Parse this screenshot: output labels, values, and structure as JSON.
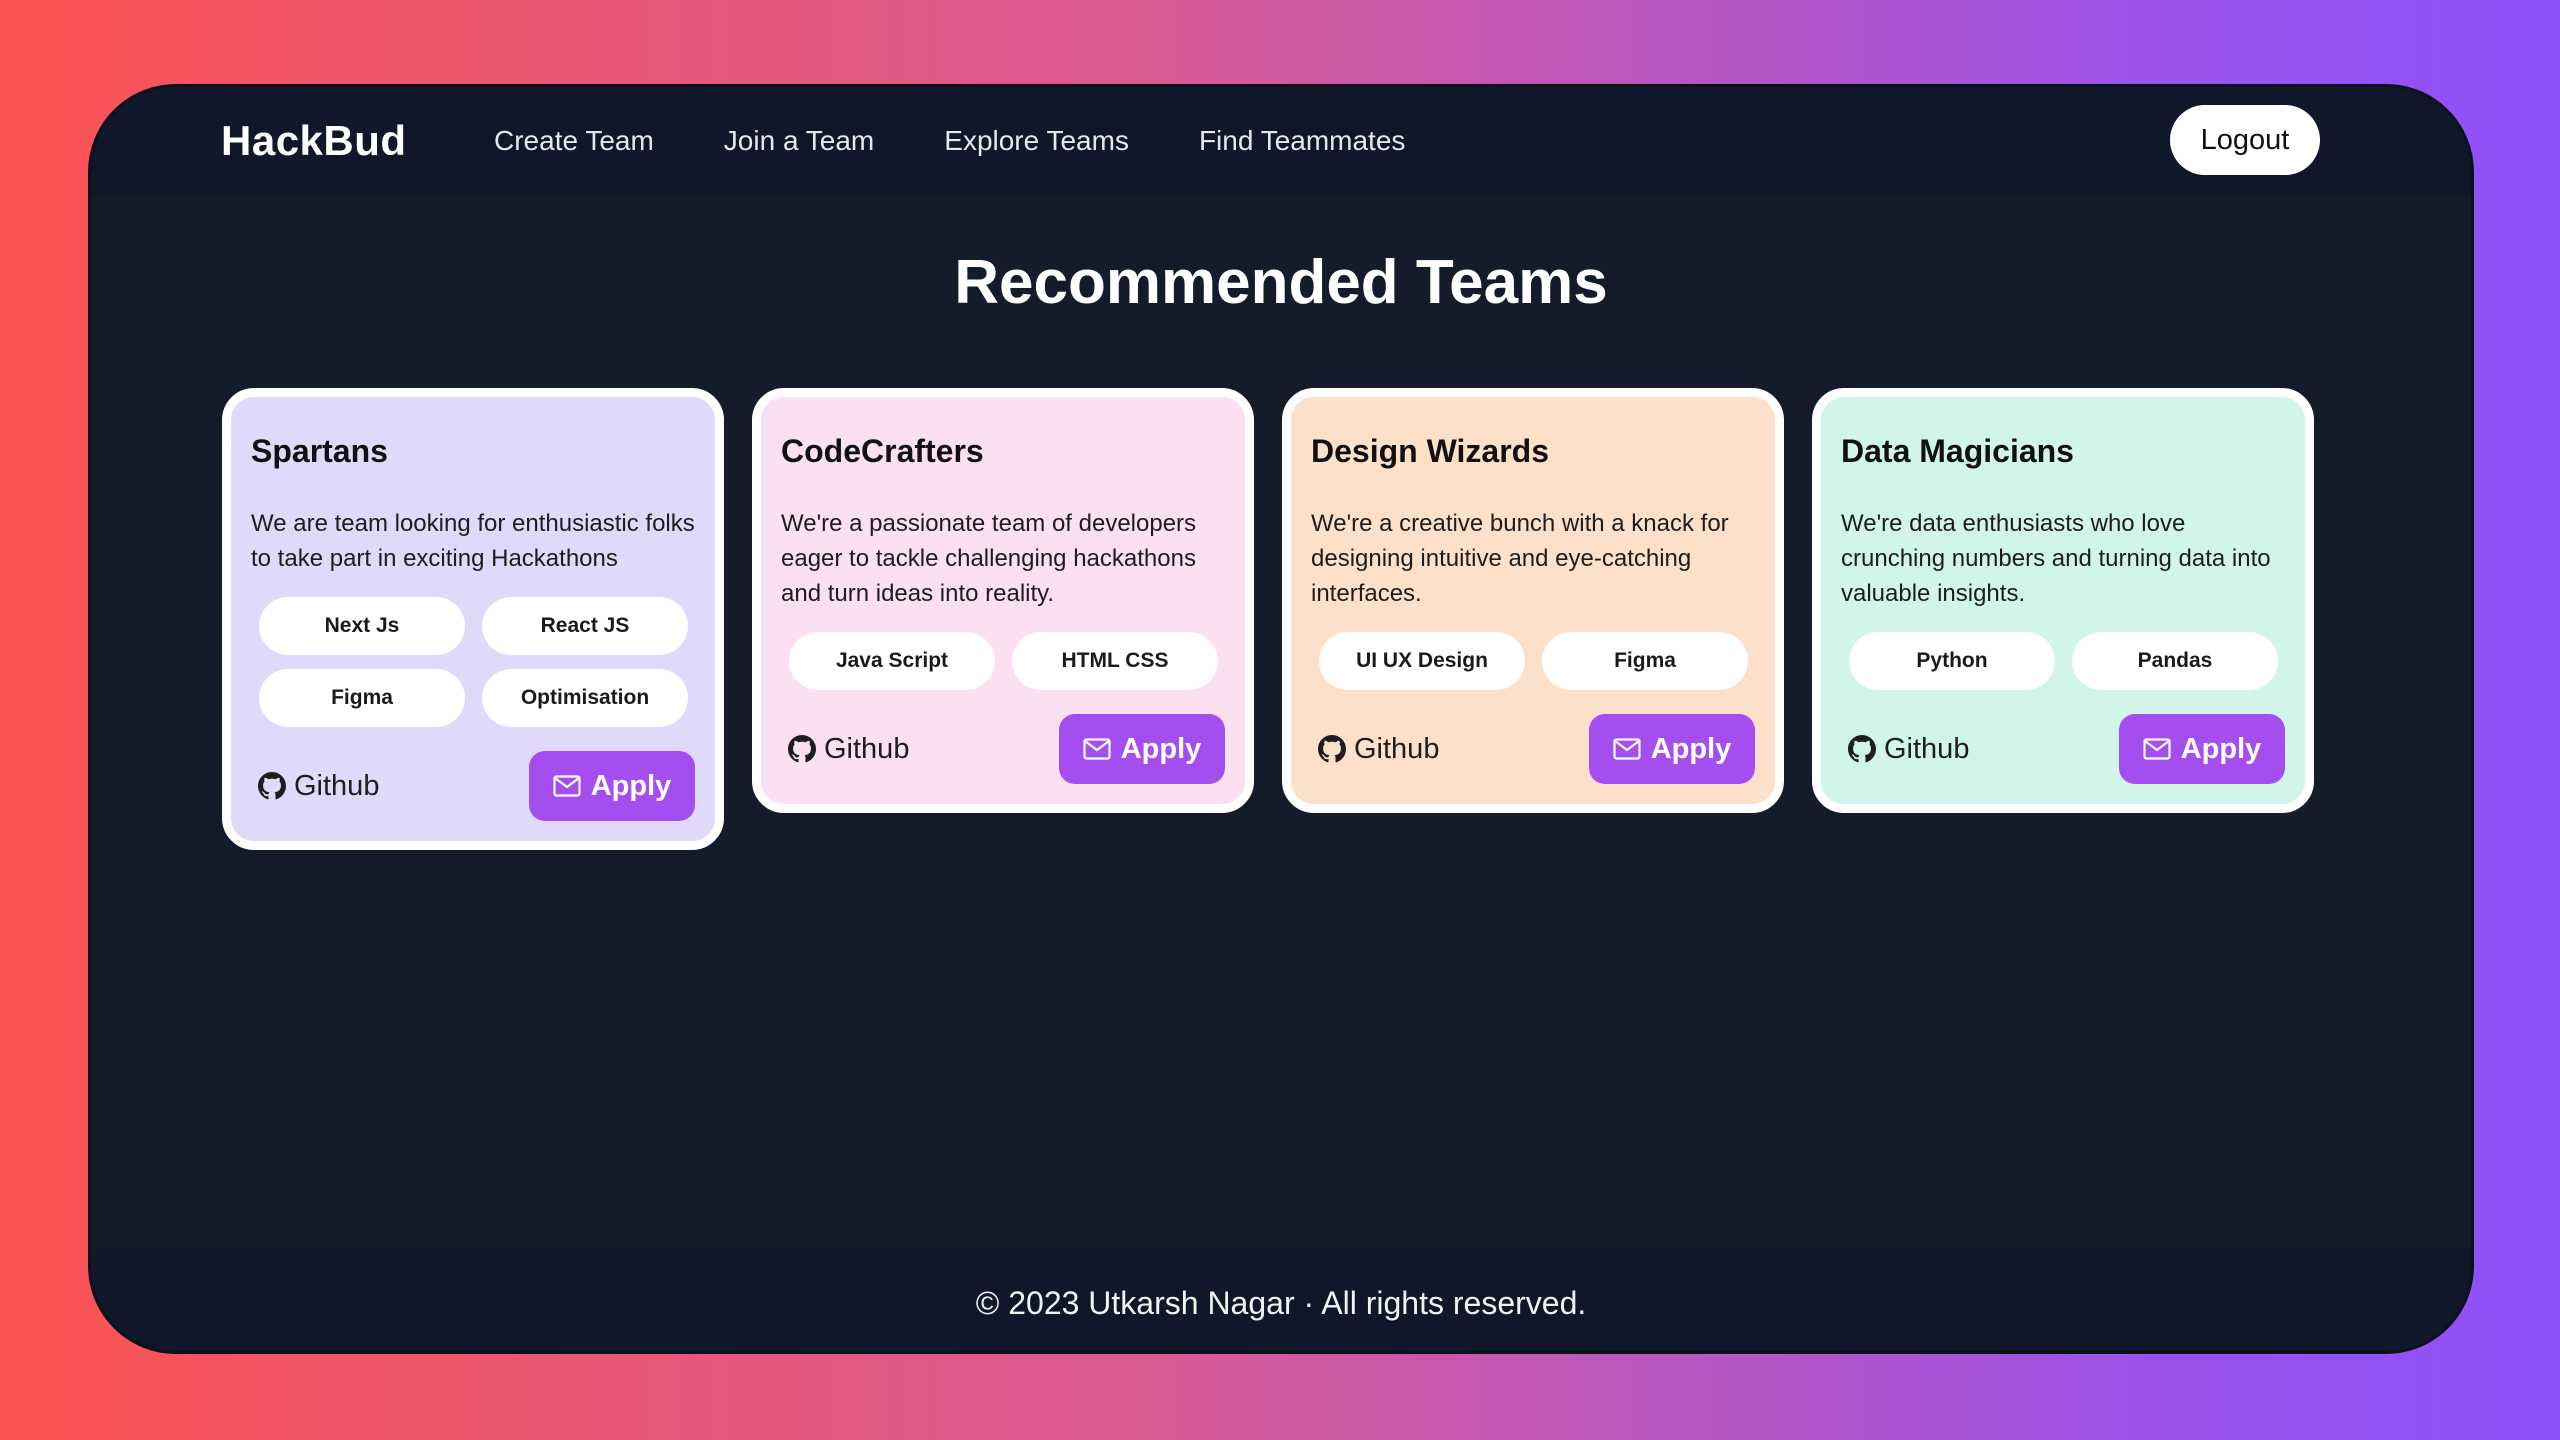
{
  "nav": {
    "brand": "HackBud",
    "links": [
      "Create Team",
      "Join a Team",
      "Explore Teams",
      "Find Teammates"
    ],
    "logout_label": "Logout"
  },
  "main": {
    "title": "Recommended Teams"
  },
  "cards": [
    {
      "name": "Spartans",
      "description": "We are team looking for enthusiastic folks to take part in exciting Hackathons",
      "tags": [
        "Next Js",
        "React JS",
        "Figma",
        "Optimisation"
      ],
      "github_label": "Github",
      "apply_label": "Apply",
      "bg_color": "#e1d9fa"
    },
    {
      "name": "CodeCrafters",
      "description": "We're a passionate team of developers eager to tackle challenging hackathons and turn ideas into reality.",
      "tags": [
        "Java Script",
        "HTML CSS"
      ],
      "github_label": "Github",
      "apply_label": "Apply",
      "bg_color": "#fae0f1"
    },
    {
      "name": "Design Wizards",
      "description": "We're a creative bunch with a knack for designing intuitive and eye-catching interfaces.",
      "tags": [
        "UI UX Design",
        "Figma"
      ],
      "github_label": "Github",
      "apply_label": "Apply",
      "bg_color": "#fde0ca"
    },
    {
      "name": "Data Magicians",
      "description": "We're data enthusiasts who love crunching numbers and turning data into valuable insights.",
      "tags": [
        "Python",
        "Pandas"
      ],
      "github_label": "Github",
      "apply_label": "Apply",
      "bg_color": "#d2f5eb"
    }
  ],
  "footer": {
    "text": "© 2023 Utkarsh Nagar · All rights reserved."
  },
  "colors": {
    "accent": "#a44ef0",
    "window_bg": "#141b2b",
    "navbar_bg": "#10172a"
  },
  "icons": {
    "github": "github-icon",
    "apply": "mail-icon"
  }
}
